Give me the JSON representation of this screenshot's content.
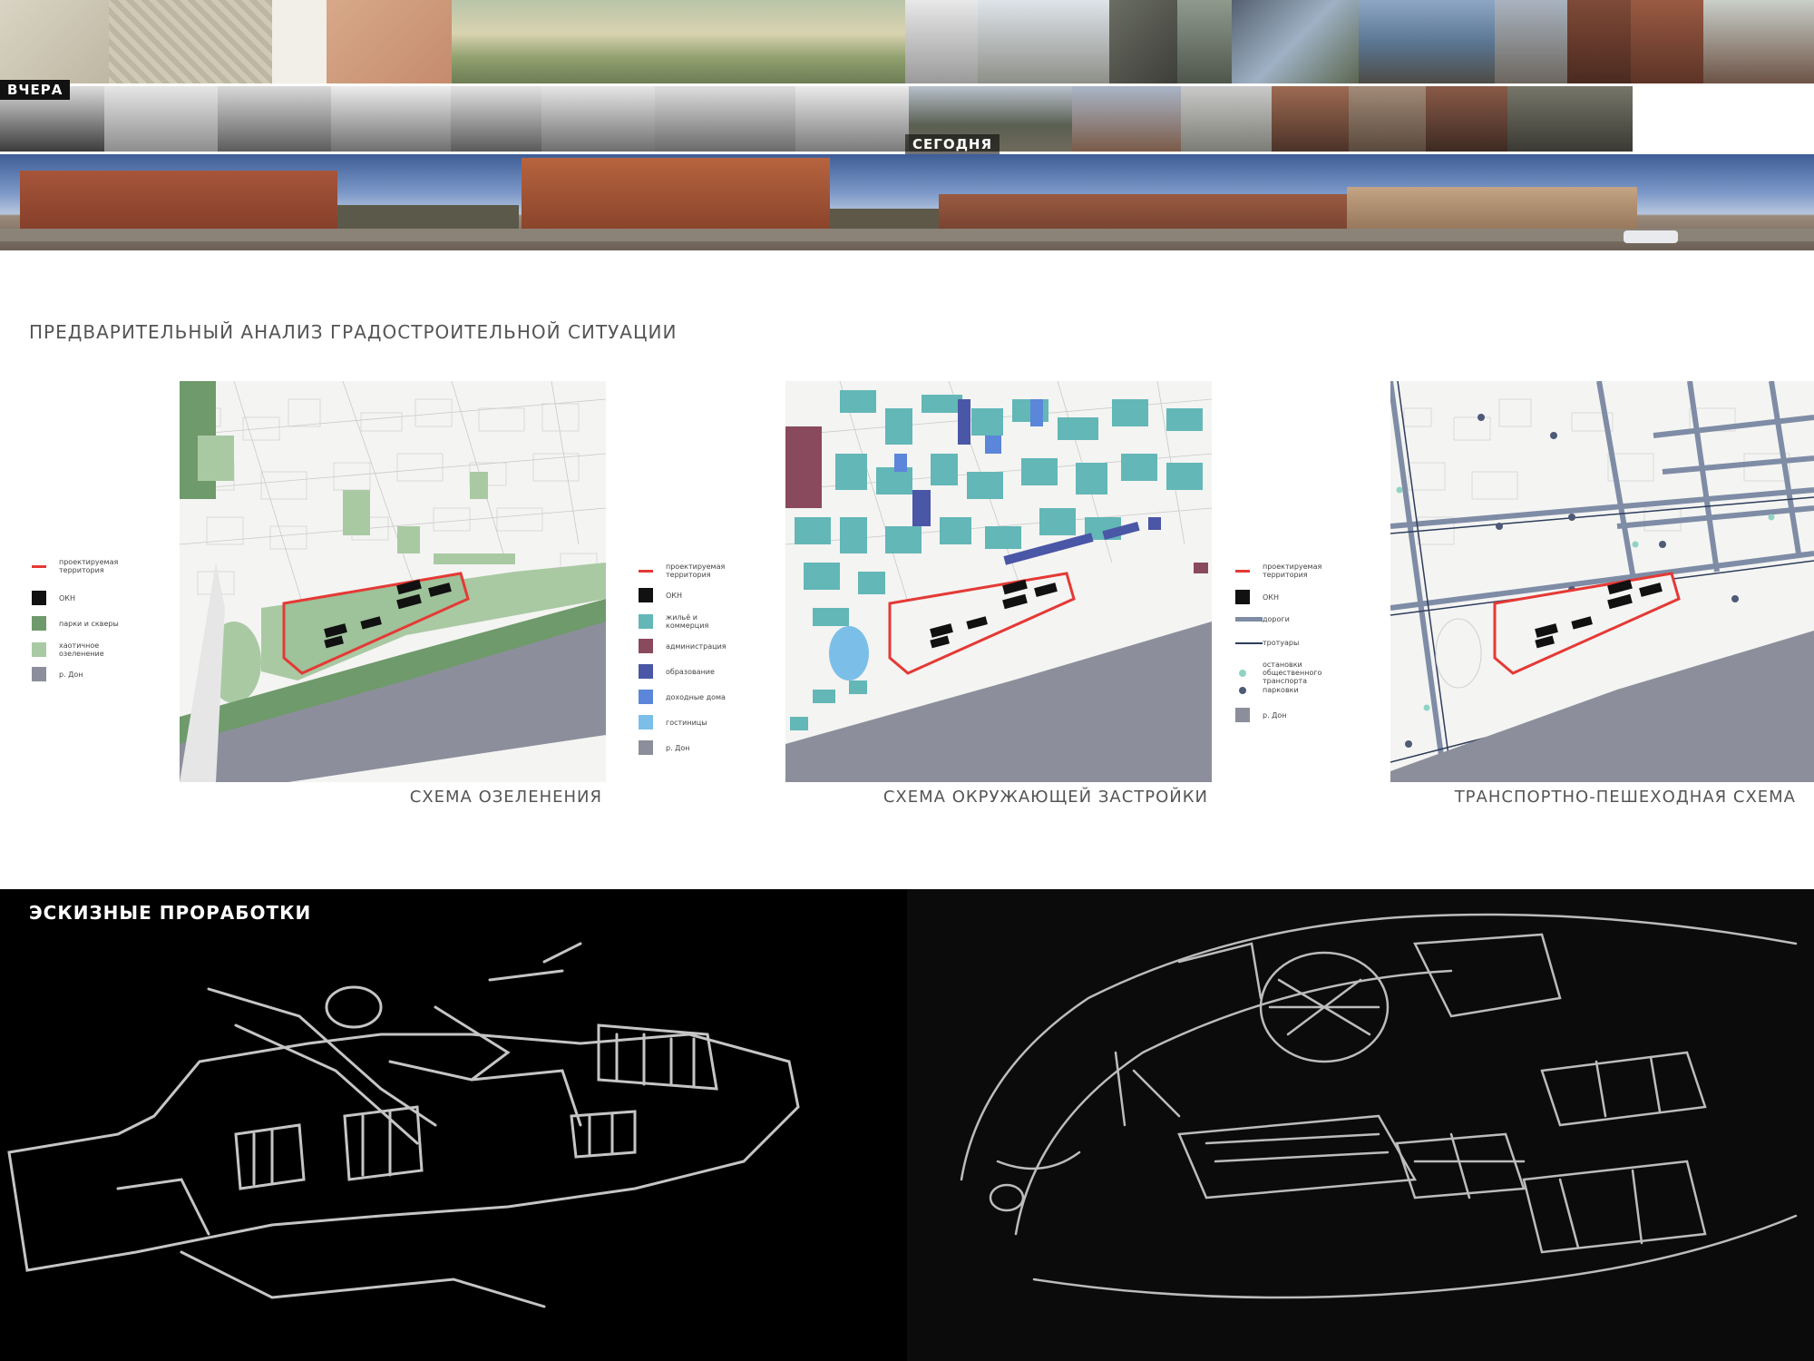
{
  "photo_labels": {
    "yesterday": "ВЧЕРА",
    "today": "СЕГОДНЯ"
  },
  "analysis": {
    "title": "ПРЕДВАРИТЕЛЬНЫЙ АНАЛИЗ ГРАДОСТРОИТЕЛЬНОЙ СИТУАЦИИ",
    "maps": [
      {
        "caption": "СХЕМА ОЗЕЛЕНЕНИЯ",
        "legend": [
          {
            "label": "проектируемая территория",
            "kind": "line",
            "color": "#e53935"
          },
          {
            "label": "ОКН",
            "kind": "box",
            "color": "#111111"
          },
          {
            "label": "парки и скверы",
            "kind": "box",
            "color": "#6f9a6b"
          },
          {
            "label": "хаотичное озеленение",
            "kind": "box",
            "color": "#a9c9a3"
          },
          {
            "label": "р. Дон",
            "kind": "box",
            "color": "#8c8f9b"
          }
        ]
      },
      {
        "caption": "СХЕМА ОКРУЖАЮЩЕЙ ЗАСТРОЙКИ",
        "legend": [
          {
            "label": "проектируемая территория",
            "kind": "line",
            "color": "#e53935"
          },
          {
            "label": "ОКН",
            "kind": "box",
            "color": "#111111"
          },
          {
            "label": "жильё и коммерция",
            "kind": "box",
            "color": "#63b7b7"
          },
          {
            "label": "администрация",
            "kind": "box",
            "color": "#8a4a5e"
          },
          {
            "label": "образование",
            "kind": "box",
            "color": "#4a56a6"
          },
          {
            "label": "доходные дома",
            "kind": "box",
            "color": "#5b86d9"
          },
          {
            "label": "гостиницы",
            "kind": "box",
            "color": "#7bbfe8"
          },
          {
            "label": "р. Дон",
            "kind": "box",
            "color": "#8c8f9b"
          }
        ]
      },
      {
        "caption": "ТРАНСПОРТНО-ПЕШЕХОДНАЯ СХЕМА",
        "legend": [
          {
            "label": "проектируемая территория",
            "kind": "line",
            "color": "#e53935"
          },
          {
            "label": "ОКН",
            "kind": "box",
            "color": "#111111"
          },
          {
            "label": "дороги",
            "kind": "thick",
            "color": "#7f8ca6"
          },
          {
            "label": "тротуары",
            "kind": "thin",
            "color": "#2e3d5c"
          },
          {
            "label": "остановки общественного транспорта",
            "kind": "dot",
            "color": "#8fd3c3"
          },
          {
            "label": "парковки",
            "kind": "dot",
            "color": "#4f5a78"
          },
          {
            "label": "р. Дон",
            "kind": "box",
            "color": "#8c8f9b"
          }
        ]
      }
    ]
  },
  "sketches": {
    "title": "ЭСКИЗНЫЕ ПРОРАБОТКИ"
  },
  "colors": {
    "river": "#8c8f9b",
    "site": "#e53935",
    "okn": "#111111",
    "sketch_bg": "#000000"
  }
}
